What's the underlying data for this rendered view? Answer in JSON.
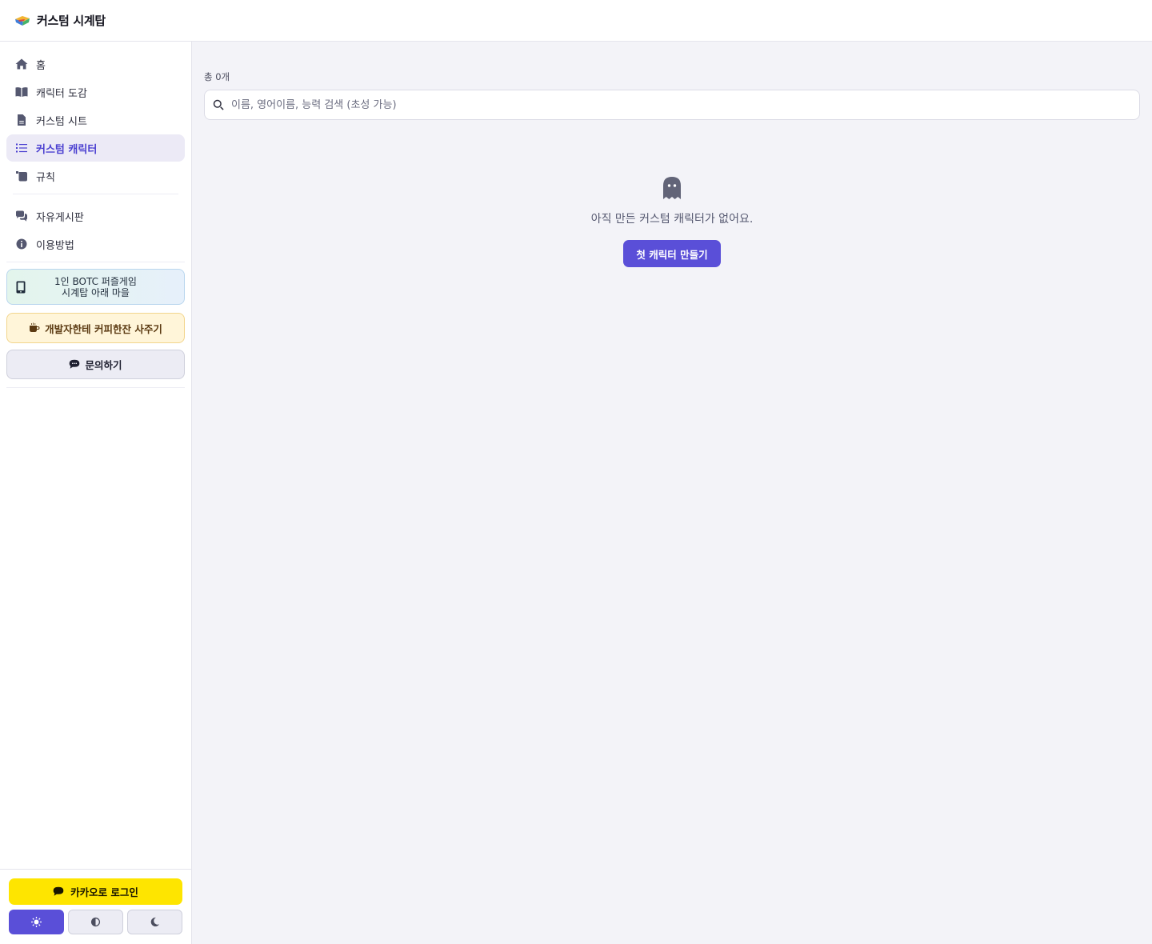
{
  "app": {
    "title": "커스텀 시계탑",
    "logo_icon": "clocktower-logo-icon"
  },
  "sidebar": {
    "items": [
      {
        "label": "홈",
        "icon": "home-icon",
        "active": false
      },
      {
        "label": "캐릭터 도감",
        "icon": "book-open-icon",
        "active": false
      },
      {
        "label": "커스텀 시트",
        "icon": "file-icon",
        "active": false
      },
      {
        "label": "커스텀 캐릭터",
        "icon": "list-icon",
        "active": true
      },
      {
        "label": "규칙",
        "icon": "scroll-icon",
        "active": false
      },
      {
        "label": "자유게시판",
        "icon": "comments-icon",
        "active": false
      },
      {
        "label": "이용방법",
        "icon": "info-circle-icon",
        "active": false
      }
    ],
    "promo": {
      "line1": "1인 BOTC 퍼즐게임",
      "line2": "시계탑 아래 마을",
      "icon": "mobile-icon"
    },
    "coffee_label": "개발자한테 커피한잔 사주기",
    "inquiry_label": "문의하기",
    "kakao_label": "카카오로 로그인",
    "theme": {
      "selected": "light",
      "options": [
        "light",
        "auto",
        "dark"
      ]
    }
  },
  "main": {
    "count_text": "총 0개",
    "search": {
      "placeholder": "이름, 영어이름, 능력 검색 (초성 가능)",
      "value": ""
    },
    "empty": {
      "icon": "ghost-icon",
      "message": "아직 만든 커스텀 캐릭터가 없어요.",
      "cta_label": "첫 캐릭터 만들기"
    }
  },
  "colors": {
    "accent": "#5a4fd8",
    "active_nav_bg": "#eceaf6",
    "kakao_yellow": "#fee500",
    "background": "#f3f3f8"
  }
}
